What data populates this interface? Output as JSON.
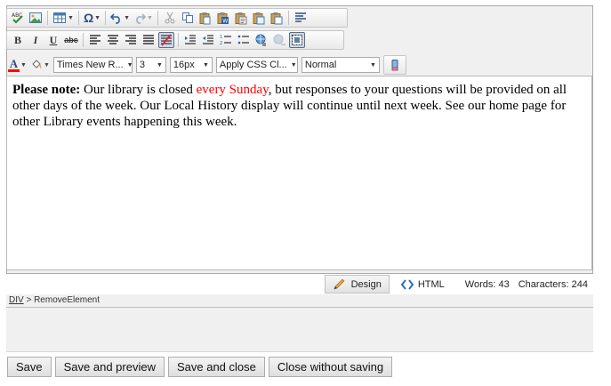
{
  "toolbar": {
    "font_name": "Times New R...",
    "font_size_value": "3",
    "real_font_size_value": "16px",
    "css_class_value": "Apply CSS Cl...",
    "paragraph_style_value": "Normal",
    "bold_glyph": "B",
    "italic_glyph": "I",
    "underline_glyph": "U",
    "strike_glyph": "abc",
    "font_color_glyph": "A",
    "symbol_glyph": "Ω"
  },
  "content": {
    "bold_lead": "Please note:",
    "text_before_red": " Our library is closed ",
    "red_text": "every Sunday",
    "text_after_red": ", but responses to your questions will be provided on all other days of the week. Our Local History display will continue until next week. See our home page for other Library events happening this week."
  },
  "status": {
    "design_label": "Design",
    "html_label": "HTML",
    "words": "Words: 43",
    "characters": "Characters: 244"
  },
  "path": {
    "tag": "DIV",
    "separator": " > ",
    "element": "RemoveElement"
  },
  "buttons": {
    "save": "Save",
    "save_preview": "Save and preview",
    "save_close": "Save and close",
    "close_no_save": "Close without saving"
  },
  "colors": {
    "red_text": "#ff0000",
    "font_color_bar": "#ff0000",
    "design_pencil": "#e8a33a",
    "html_icon": "#2b6fb8"
  }
}
